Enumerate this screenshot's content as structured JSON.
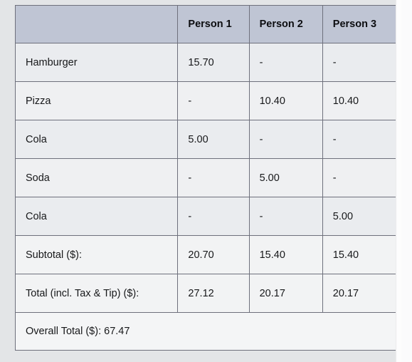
{
  "table": {
    "columns": [
      "",
      "Person 1",
      "Person 2",
      "Person 3"
    ],
    "rows": [
      {
        "label": "Hamburger",
        "values": [
          "15.70",
          "-",
          "-"
        ]
      },
      {
        "label": "Pizza",
        "values": [
          "-",
          "10.40",
          "10.40"
        ]
      },
      {
        "label": "Cola",
        "values": [
          "5.00",
          "-",
          "-"
        ]
      },
      {
        "label": "Soda",
        "values": [
          "-",
          "5.00",
          "-"
        ]
      },
      {
        "label": "Cola",
        "values": [
          "-",
          "-",
          "5.00"
        ]
      }
    ],
    "summary_rows": [
      {
        "label": "Subtotal ($):",
        "values": [
          "20.70",
          "15.40",
          "15.40"
        ]
      },
      {
        "label": "Total (incl. Tax & Tip) ($):",
        "values": [
          "27.12",
          "20.17",
          "20.17"
        ]
      }
    ],
    "overall": "Overall Total ($): 67.47"
  },
  "colors": {
    "header_background": "#bfc5d4",
    "row_background": "#eaecef",
    "row_background_alt": "#eff0f2",
    "summary_background": "#f2f3f4",
    "overall_background": "#f4f5f6",
    "border": "#6e707c",
    "page_background": "#e3e5e7",
    "text": "#17181a"
  }
}
